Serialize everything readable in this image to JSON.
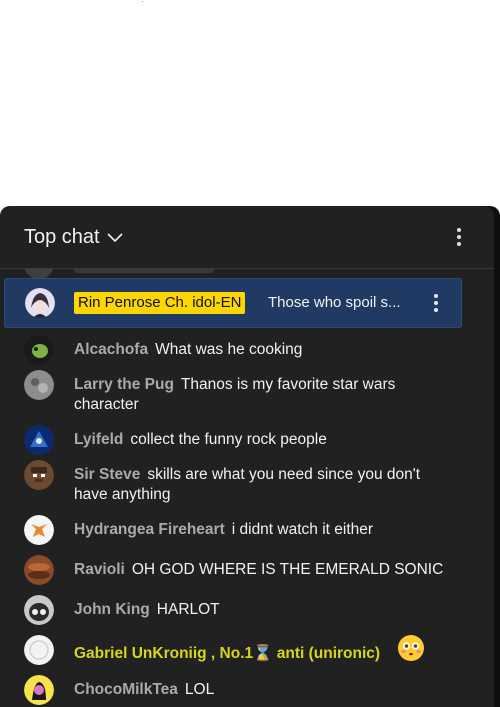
{
  "header": {
    "title": "Top chat"
  },
  "pinned": {
    "author": "Rin Penrose Ch. idol-EN",
    "message": "Those who spoil s..."
  },
  "messages": [
    {
      "author": "Alcachofa",
      "text": "What was he cooking"
    },
    {
      "author": "Larry the Pug",
      "text": "Thanos is my favorite star wars character"
    },
    {
      "author": "Lyifeld",
      "text": "collect the funny rock people"
    },
    {
      "author": "Sir Steve",
      "text": "skills are what you need since you don't have anything"
    },
    {
      "author": "Hydrangea Fireheart",
      "text": "i didnt watch it either"
    },
    {
      "author": "Ravioli",
      "text": "OH GOD WHERE IS THE EMERALD SONIC"
    },
    {
      "author": "John King",
      "text": "HARLOT"
    },
    {
      "author": "Gabriel UnKroniig , No.1⌛ anti (unironic)",
      "text": ""
    },
    {
      "author": "ChocoMilkTea",
      "text": "LOL"
    }
  ],
  "colors": {
    "panel_bg": "#212121",
    "pinned_bg": "#213a63",
    "owner_badge": "#ffd600",
    "member_name": "#d6d61c",
    "author": "#aaaaaa"
  },
  "icons": {
    "header_dropdown": "chevron-down-icon",
    "menu": "more-vert-icon",
    "flushed_emoji": "flushed-face-emoji-icon"
  }
}
